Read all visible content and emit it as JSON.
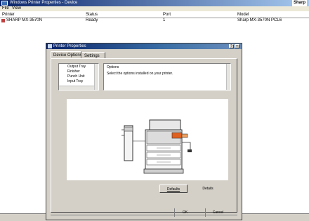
{
  "window": {
    "title": "Windows Printer Properties - Device",
    "logo": "Sharp"
  },
  "menu": {
    "file": "File",
    "view": "View"
  },
  "list": {
    "headers": [
      "Printer",
      "Status",
      "Port",
      "Model"
    ],
    "row": [
      "SHARP MX-3570N",
      "Ready",
      "1",
      "Sharp MX-3570N PCL6"
    ]
  },
  "dialog": {
    "title": "Printer Properties",
    "help_button": "?",
    "close_button": "×",
    "tabs": {
      "device": "Device Options",
      "settings": "Settings"
    },
    "options": [
      "Output Tray",
      "Finisher",
      "Punch Unit",
      "Input Tray"
    ],
    "description": [
      "Options",
      "Select the options installed on your printer."
    ],
    "buttons": {
      "reset": "Defaults",
      "detail": "Details",
      "ok": "OK",
      "cancel": "Cancel"
    }
  },
  "colors": {
    "titlebar": "#0a246a",
    "accent": "#e06020"
  }
}
